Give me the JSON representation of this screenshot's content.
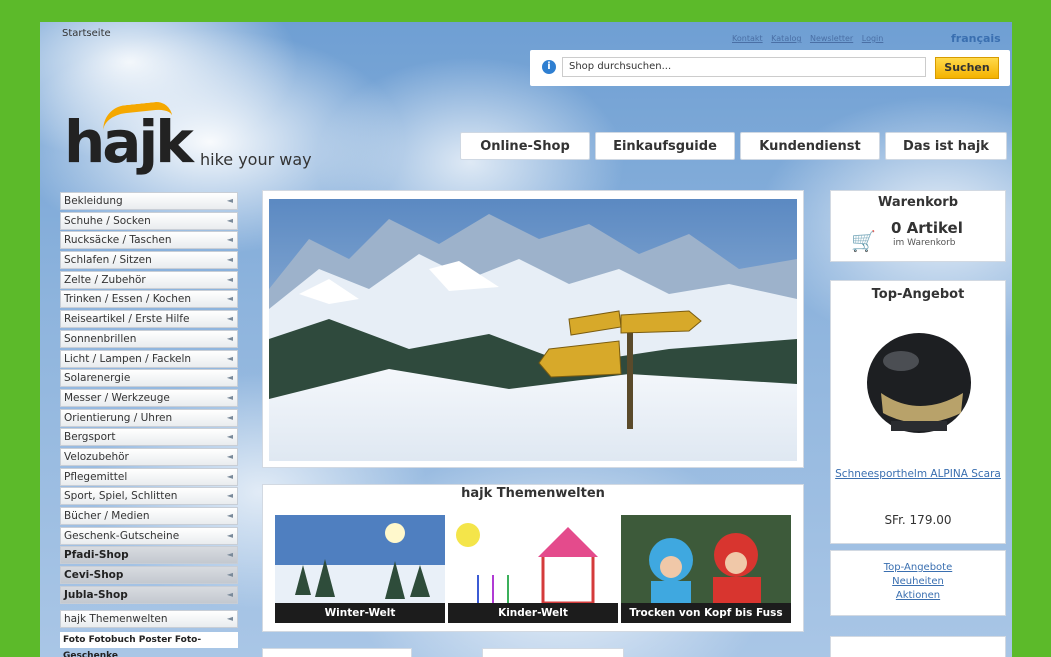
{
  "breadcrumb": "Startseite",
  "top_links": [
    "Kontakt",
    "Katalog",
    "Newsletter",
    "Login"
  ],
  "language": "français",
  "search": {
    "placeholder": "Shop durchsuchen...",
    "button": "Suchen"
  },
  "logo": {
    "word": "hajk",
    "tagline": "hike your way"
  },
  "nav": [
    "Online-Shop",
    "Einkaufsguide",
    "Kundendienst",
    "Das ist hajk"
  ],
  "sidebar": {
    "categories": [
      "Bekleidung",
      "Schuhe / Socken",
      "Rucksäcke / Taschen",
      "Schlafen / Sitzen",
      "Zelte / Zubehör",
      "Trinken / Essen / Kochen",
      "Reiseartikel / Erste Hilfe",
      "Sonnenbrillen",
      "Licht / Lampen / Fackeln",
      "Solarenergie",
      "Messer / Werkzeuge",
      "Orientierung / Uhren",
      "Bergsport",
      "Velozubehör",
      "Pflegemittel",
      "Sport, Spiel, Schlitten",
      "Bücher / Medien",
      "Geschenk-Gutscheine"
    ],
    "shops": [
      "Pfadi-Shop",
      "Cevi-Shop",
      "Jubla-Shop"
    ],
    "themenwelten": "hajk Themenwelten",
    "foto_bar": "Foto  Fotobuch  Poster  Foto-Geschenke"
  },
  "themenwelten": {
    "title": "hajk Themenwelten",
    "tiles": [
      "Winter-Welt",
      "Kinder-Welt",
      "Trocken von Kopf bis Fuss"
    ]
  },
  "cart": {
    "title": "Warenkorb",
    "count": "0 Artikel",
    "sub": "im Warenkorb"
  },
  "top_offer": {
    "title": "Top-Angebot",
    "product": "Schneesporthelm ALPINA Scara",
    "price": "SFr. 179.00"
  },
  "more_links": [
    "Top-Angebote",
    "Neuheiten",
    "Aktionen"
  ],
  "colors": {
    "frame_green": "#5cba2a",
    "search_button": "#f4b200",
    "logo_accent": "#f5a800",
    "link_blue": "#3a6fb0"
  },
  "icons": [
    "info-icon",
    "arrow-left-icon",
    "cart-icon"
  ]
}
